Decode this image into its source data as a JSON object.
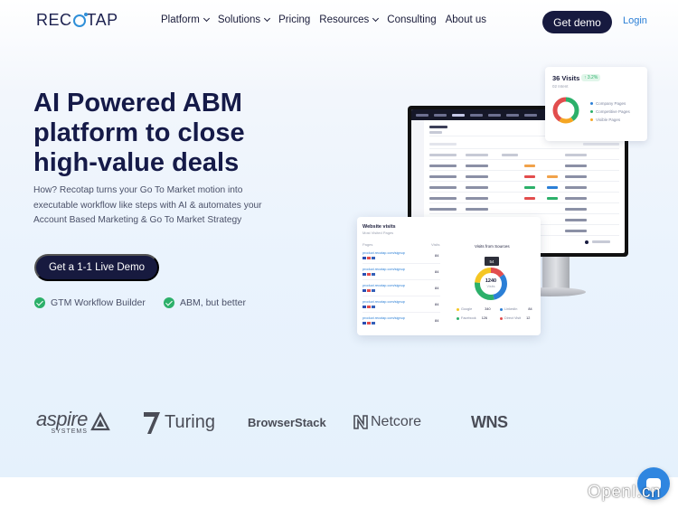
{
  "nav": {
    "logo_left": "REC",
    "logo_right": "TAP",
    "items": [
      {
        "label": "Platform",
        "dropdown": true
      },
      {
        "label": "Solutions",
        "dropdown": true
      },
      {
        "label": "Pricing",
        "dropdown": false
      },
      {
        "label": "Resources",
        "dropdown": true
      },
      {
        "label": "Consulting",
        "dropdown": false
      },
      {
        "label": "About us",
        "dropdown": false
      }
    ],
    "demo_label": "Get demo",
    "login_label": "Login"
  },
  "hero": {
    "headline_1": "AI Powered ABM",
    "headline_2": "platform to close",
    "headline_3": "high-value deals",
    "sub_1": "How? Recotap turns your Go To Market motion into",
    "sub_2": "executable workflow like steps with AI & automates your",
    "sub_3": "Account Based Marketing & Go To Market Strategy",
    "cta_label": "Get a 1-1 Live Demo",
    "features": [
      "GTM Workflow Builder",
      "ABM, but better"
    ]
  },
  "visits_card": {
    "title": "36 Visits",
    "badge": "↑ 3.2%",
    "sub": "02 Intent",
    "legend": [
      "Company Pages",
      "Competitive Pages",
      "Visible Pages"
    ]
  },
  "web_card": {
    "title": "Website visits",
    "sub": "Most Visited Pages",
    "col_pages": "Pages",
    "col_visits": "Visits",
    "rows": [
      {
        "url": "product.recotap.com/signup",
        "visits": "84"
      },
      {
        "url": "product.recotap.com/signup",
        "visits": "84"
      },
      {
        "url": "product.recotap.com/signup",
        "visits": "84"
      },
      {
        "url": "product.recotap.com/signup",
        "visits": "84"
      },
      {
        "url": "product.recotap.com/signup",
        "visits": "84"
      }
    ],
    "sources_title": "Visits from Sources",
    "donut_value": "1240",
    "donut_label": "Visits",
    "tooltip": "54",
    "legend": [
      {
        "label": "Google",
        "value": "340"
      },
      {
        "label": "LinkedIn",
        "value": "84"
      },
      {
        "label": "Facebook",
        "value": "126"
      },
      {
        "label": "Direct Visit",
        "value": "12"
      }
    ]
  },
  "logos": [
    "aspire",
    "SYSTEMS",
    "Turing",
    "BrowserStack",
    "Netcore",
    "WNS"
  ],
  "watermark": "OpenI.cn",
  "colors": {
    "navy": "#171a3f",
    "link": "#2b7fd6",
    "green": "#2cb06a",
    "chat": "#2f86e0"
  }
}
